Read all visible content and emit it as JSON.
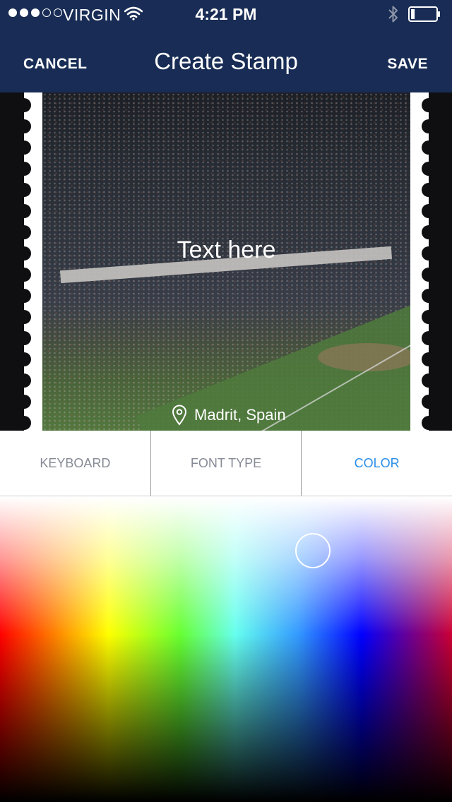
{
  "status_bar": {
    "carrier": "VIRGIN",
    "signal_bars_filled": 3,
    "signal_bars_total": 5,
    "time": "4:21 PM",
    "icons": [
      "wifi-icon",
      "bluetooth-icon",
      "battery-icon"
    ],
    "battery_level": 0.15
  },
  "nav": {
    "cancel_label": "CANCEL",
    "title": "Create Stamp",
    "save_label": "SAVE"
  },
  "stamp": {
    "text": "Text here",
    "location": "Madrit, Spain",
    "location_icon": "map-pin-icon"
  },
  "tabs": [
    {
      "label": "KEYBOARD",
      "active": false
    },
    {
      "label": "FONT TYPE",
      "active": false
    },
    {
      "label": "COLOR",
      "active": true
    }
  ],
  "colors": {
    "nav_background": "#182c55",
    "active_tab": "#2a8ee8",
    "inactive_tab": "#858a95"
  }
}
